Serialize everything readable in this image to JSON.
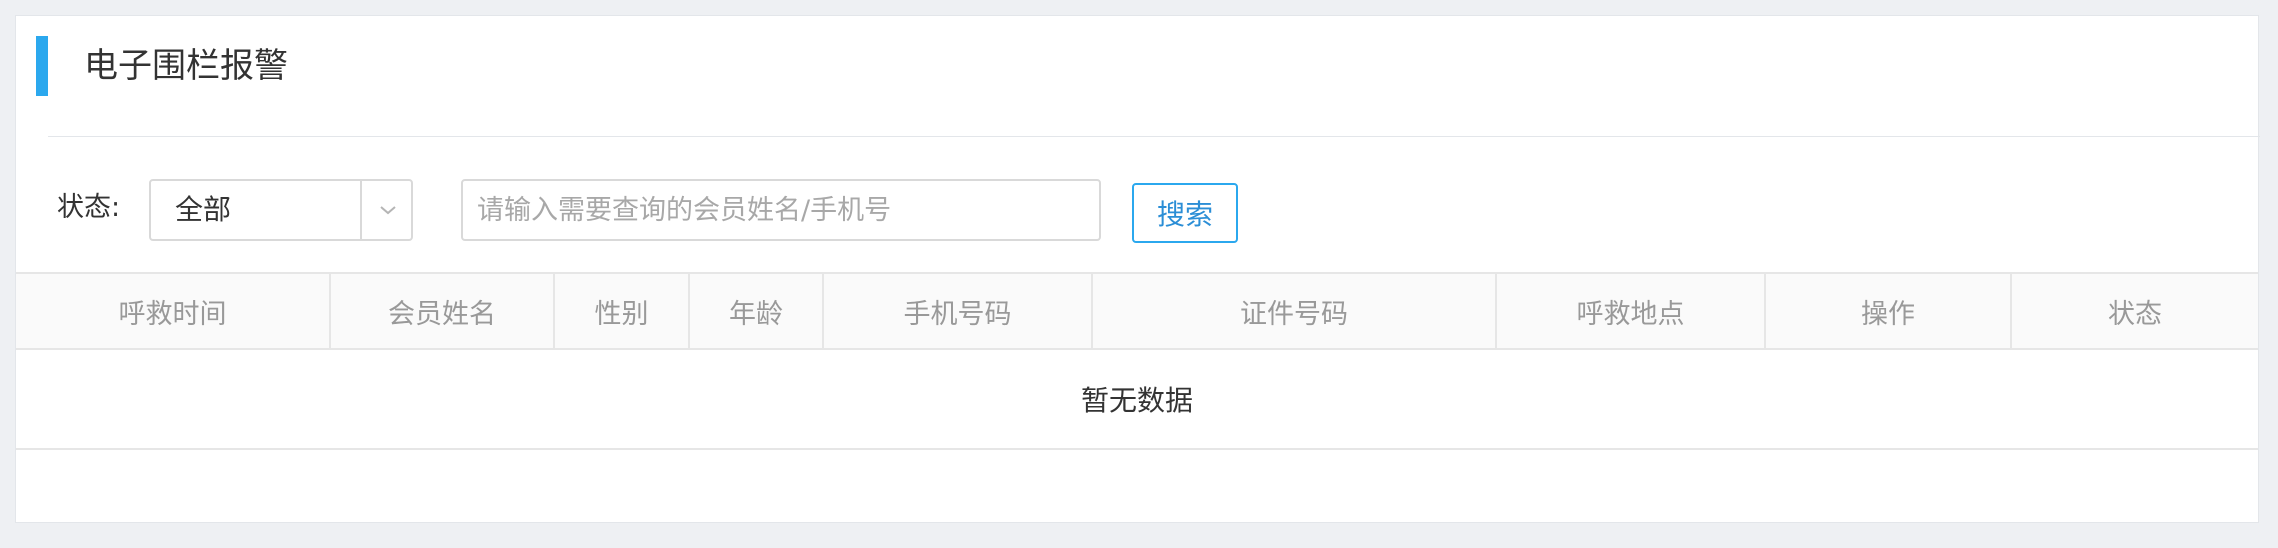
{
  "header": {
    "title": "电子围栏报警",
    "accent_color": "#2ba8ee"
  },
  "filters": {
    "status_label": "状态:",
    "status_select": {
      "value": "全部",
      "icon": "chevron-down-icon"
    },
    "search": {
      "placeholder": "请输入需要查询的会员姓名/手机号",
      "value": ""
    },
    "search_button_label": "搜索"
  },
  "table": {
    "columns": [
      "呼救时间",
      "会员姓名",
      "性别",
      "年龄",
      "手机号码",
      "证件号码",
      "呼救地点",
      "操作",
      "状态"
    ],
    "empty_text": "暂无数据"
  }
}
